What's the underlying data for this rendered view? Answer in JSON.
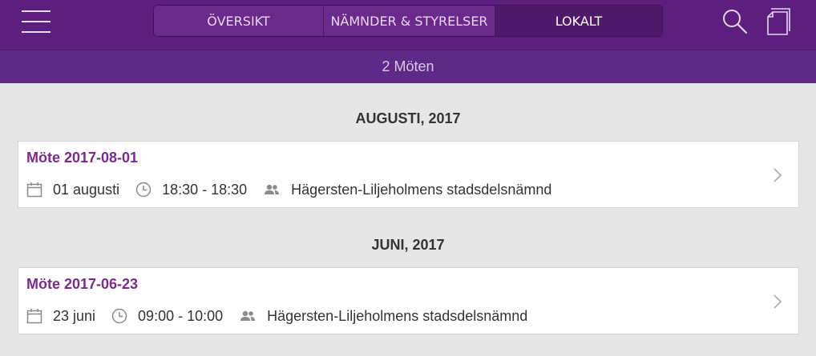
{
  "nav": {
    "tabs": [
      {
        "label": "ÖVERSIKT"
      },
      {
        "label": "NÄMNDER & STYRELSER"
      },
      {
        "label": "LOKALT",
        "active": true
      }
    ]
  },
  "subheader": {
    "count_label": "2 Möten"
  },
  "sections": [
    {
      "heading": "AUGUSTI, 2017",
      "meetings": [
        {
          "title": "Möte 2017-08-01",
          "date": "01 augusti",
          "time": "18:30 - 18:30",
          "committee": "Hägersten-Liljeholmens stadsdelsnämnd"
        }
      ]
    },
    {
      "heading": "JUNI, 2017",
      "meetings": [
        {
          "title": "Möte 2017-06-23",
          "date": "23 juni",
          "time": "09:00 - 10:00",
          "committee": "Hägersten-Liljeholmens stadsdelsnämnd"
        }
      ]
    }
  ],
  "icons": {
    "menu": "hamburger-menu-icon",
    "search": "search-icon",
    "copy": "copy-icon",
    "date": "calendar-icon",
    "time": "clock-icon",
    "committee": "people-icon",
    "open": "chevron-right-icon"
  },
  "colors": {
    "header_bg": "#5d1f7d",
    "active_tab_bg": "#4f1969",
    "meeting_title": "#7a2a8f",
    "page_bg": "#e6e6e6"
  }
}
